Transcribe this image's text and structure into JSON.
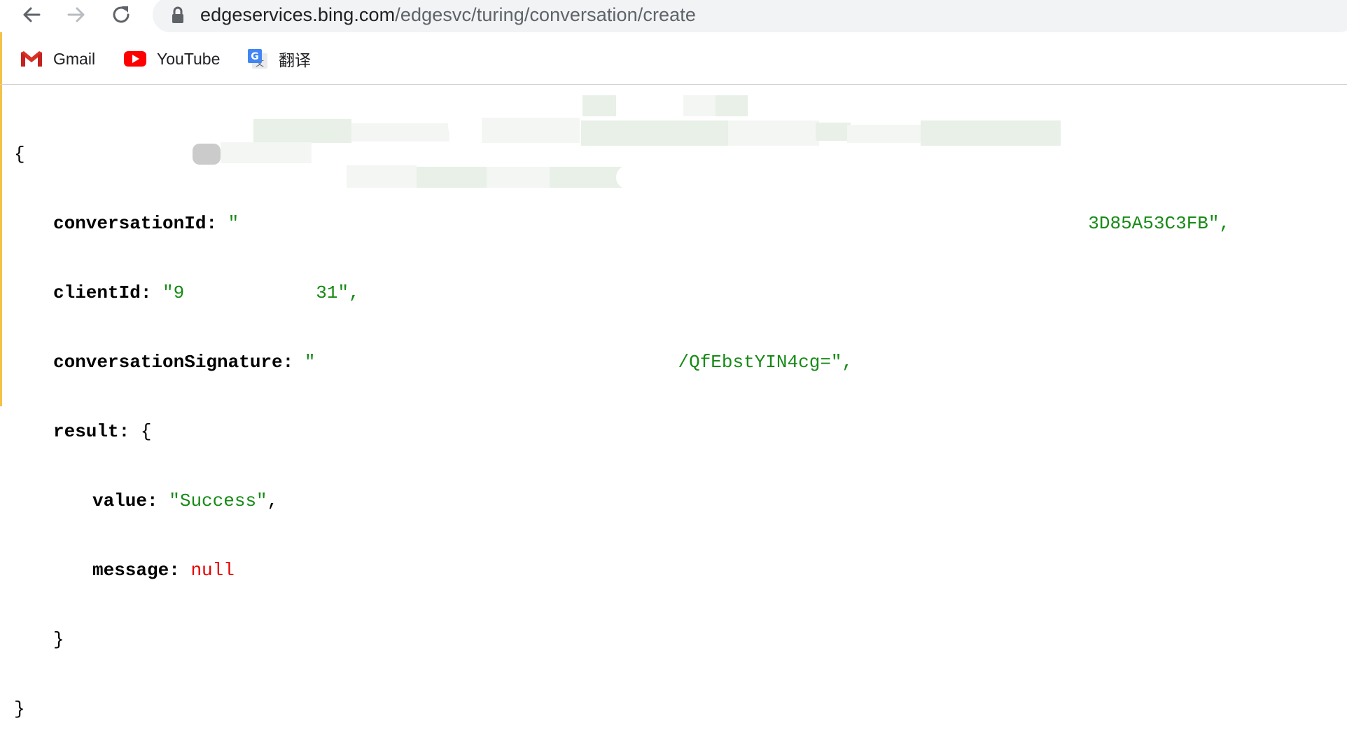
{
  "browser": {
    "url_host": "edgeservices.bing.com",
    "url_path": "/edgesvc/turing/conversation/create"
  },
  "bookmarks": [
    {
      "label": "Gmail",
      "icon": "gmail-icon"
    },
    {
      "label": "YouTube",
      "icon": "youtube-icon"
    },
    {
      "label": "翻译",
      "icon": "google-translate-icon"
    }
  ],
  "json": {
    "open_brace": "{",
    "close_brace": "}",
    "conversationId_key": "conversationId:",
    "conversationId_value_visible": "\"",
    "conversationId_value_tail": "3D85A53C3FB\",",
    "clientId_key": "clientId:",
    "clientId_value_head": "\"9",
    "clientId_value_tail": "31\",",
    "signature_key": "conversationSignature:",
    "signature_value_head": "\"",
    "signature_value_tail": "/QfEbstYIN4cg=\",",
    "result_key": "result:",
    "result_open": "{",
    "value_key": "value:",
    "value_value": "\"Success\"",
    "message_key": "message:",
    "message_value": "null",
    "result_close": "}",
    "comma": ","
  },
  "colors": {
    "string": "#168a16",
    "null": "#e60000",
    "omnibox": "#f1f3f4"
  }
}
